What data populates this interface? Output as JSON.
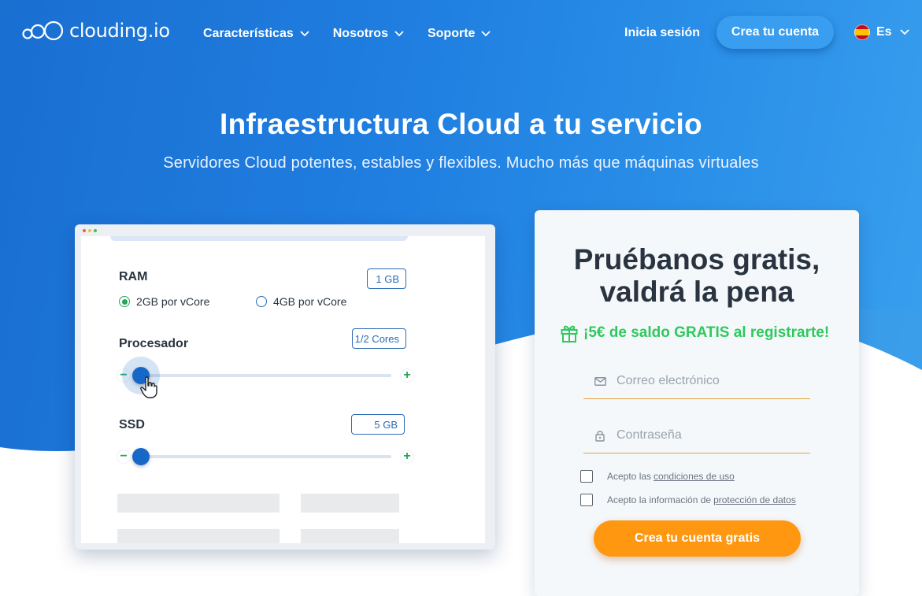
{
  "nav": {
    "logo_text": "clouding.io",
    "menu": [
      {
        "label": "Características"
      },
      {
        "label": "Nosotros"
      },
      {
        "label": "Soporte"
      }
    ],
    "login": "Inicia sesión",
    "signup": "Crea tu cuenta",
    "language": "Es"
  },
  "hero": {
    "title": "Infraestructura Cloud a tu servicio",
    "subtitle": "Servidores Cloud potentes, estables y flexibles. Mucho más que máquinas virtuales"
  },
  "configurator": {
    "ram": {
      "label": "RAM",
      "badge": "1 GB",
      "options": [
        "2GB por vCore",
        "4GB por vCore"
      ],
      "selected_index": 0
    },
    "cpu": {
      "label": "Procesador",
      "badge": "1/2 Cores",
      "level": 0.0
    },
    "ssd": {
      "label": "SSD",
      "badge": "5 GB",
      "level": 0.0
    },
    "minus_symbol": "−",
    "plus_symbol": "+"
  },
  "signup_card": {
    "title_line1": "Pruébanos gratis,",
    "title_line2": "valdrá la pena",
    "promo": "¡5€ de saldo GRATIS al registrarte!",
    "email": {
      "placeholder": "Correo electrónico",
      "value": ""
    },
    "password": {
      "placeholder": "Contraseña",
      "value": ""
    },
    "terms": {
      "prefix": "Acepto las",
      "link": "condiciones de uso"
    },
    "privacy": {
      "prefix": "Acepto la información de",
      "link": "protección de datos"
    },
    "submit": "Crea tu cuenta gratis"
  },
  "colors": {
    "brand_blue": "#1a6fd1",
    "accent_green": "#2ec95c",
    "cta_orange": "#ff9810",
    "slider_blue": "#1668c8"
  },
  "icons": {
    "gift": "gift-icon",
    "mail": "mail-icon",
    "lock": "lock-icon",
    "chevron": "chevron-down-icon",
    "flag": "spain-flag-icon",
    "cursor": "hand-cursor-icon"
  }
}
